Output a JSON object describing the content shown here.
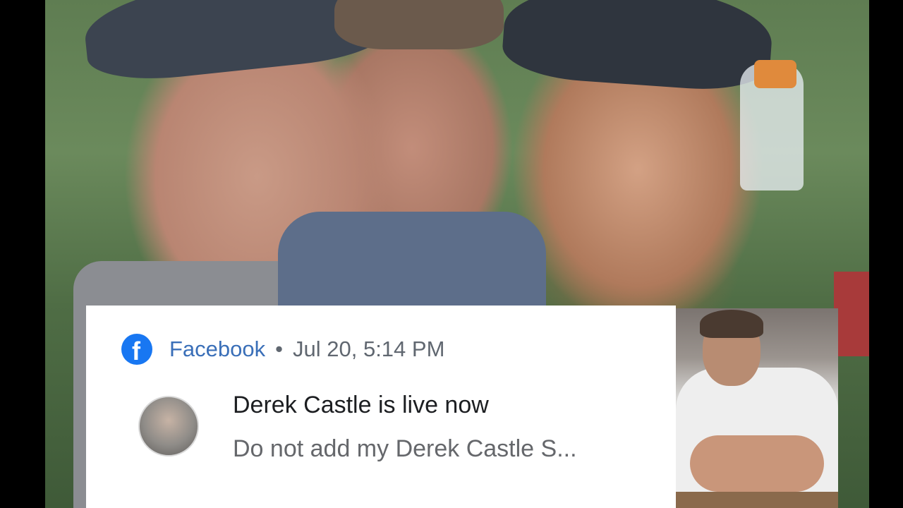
{
  "notification": {
    "app_icon": "facebook-icon",
    "app_name": "Facebook",
    "separator": "•",
    "timestamp": "Jul 20, 5:14 PM",
    "title": "Derek Castle is live now",
    "message": "Do not add my Derek Castle S..."
  },
  "colors": {
    "facebook_blue": "#1877f2",
    "app_name_color": "#3a6fb8",
    "title_color": "#1c1e21",
    "secondary_text": "#65676b",
    "card_background": "#ffffff"
  }
}
